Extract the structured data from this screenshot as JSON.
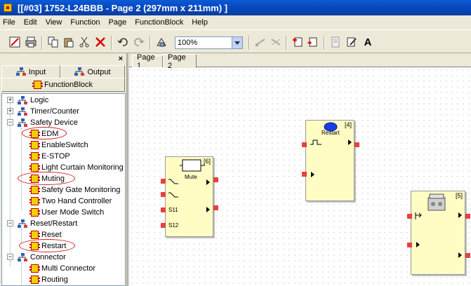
{
  "window": {
    "title": "[[#03] 1752-L24BBB - Page 2 (297mm x 211mm) ]"
  },
  "menu": [
    "File",
    "Edit",
    "View",
    "Function",
    "Page",
    "FunctionBlock",
    "Help"
  ],
  "toolbar": {
    "zoom_value": "100%"
  },
  "left_pane": {
    "close_glyph": "×",
    "tabs": {
      "input": "Input",
      "output": "Output",
      "function_block": "FunctionBlock"
    },
    "tree": {
      "logic": "Logic",
      "timer_counter": "Timer/Counter",
      "safety_device": "Safety Device",
      "edm": "EDM",
      "enable_switch": "EnableSwitch",
      "estop": "E-STOP",
      "light_curtain": "Light Curtain Monitoring",
      "muting": "Muting",
      "safety_gate": "Safety Gate Monitoring",
      "two_hand": "Two Hand Controller",
      "user_mode": "User Mode Switch",
      "reset_restart": "Reset/Restart",
      "reset": "Reset",
      "restart": "Restart",
      "connector": "Connector",
      "multi_connector": "Multi Connector",
      "routing": "Routing"
    }
  },
  "canvas": {
    "tabs": [
      "Page 1",
      "Page 2"
    ],
    "active_tab": "Page 2",
    "blocks": {
      "mute": {
        "number": "[6]",
        "label": "Mute",
        "pin_s11": "S11",
        "pin_s12": "S12"
      },
      "restart": {
        "number": "[4]",
        "label": "Restart"
      },
      "edm": {
        "number": "[5]"
      }
    }
  },
  "colors": {
    "title_bar": "#0a4fc8",
    "block_fill": "#fffcc4",
    "pin": "#e84040",
    "highlight_ellipse": "#d42020"
  }
}
